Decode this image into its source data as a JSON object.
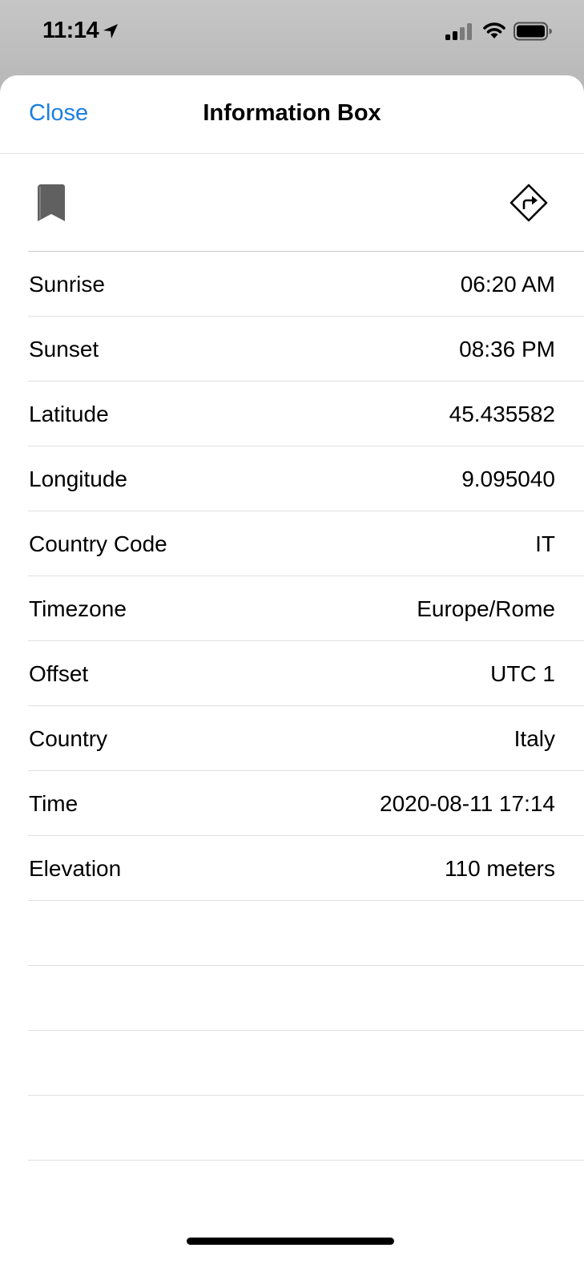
{
  "status_bar": {
    "time": "11:14",
    "icons": [
      "location-arrow-icon",
      "signal-icon",
      "wifi-icon",
      "battery-icon"
    ]
  },
  "nav": {
    "close_label": "Close",
    "title": "Information Box"
  },
  "toolbar": {
    "icons": [
      "bookmark-icon",
      "directions-icon"
    ]
  },
  "rows": [
    {
      "label": "Sunrise",
      "value": "06:20 AM"
    },
    {
      "label": "Sunset",
      "value": "08:36 PM"
    },
    {
      "label": "Latitude",
      "value": "45.435582"
    },
    {
      "label": "Longitude",
      "value": "9.095040"
    },
    {
      "label": "Country Code",
      "value": "IT"
    },
    {
      "label": "Timezone",
      "value": "Europe/Rome"
    },
    {
      "label": "Offset",
      "value": "UTC 1"
    },
    {
      "label": "Country",
      "value": "Italy"
    },
    {
      "label": "Time",
      "value": "2020-08-11 17:14"
    },
    {
      "label": "Elevation",
      "value": "110 meters"
    },
    {
      "label": "",
      "value": ""
    },
    {
      "label": "",
      "value": ""
    },
    {
      "label": "",
      "value": ""
    },
    {
      "label": "",
      "value": ""
    }
  ],
  "colors": {
    "accent": "#1d7fe0",
    "sheet_background": "#ffffff",
    "backdrop": "#bfbfbf",
    "separator": "#e0e0e3"
  }
}
